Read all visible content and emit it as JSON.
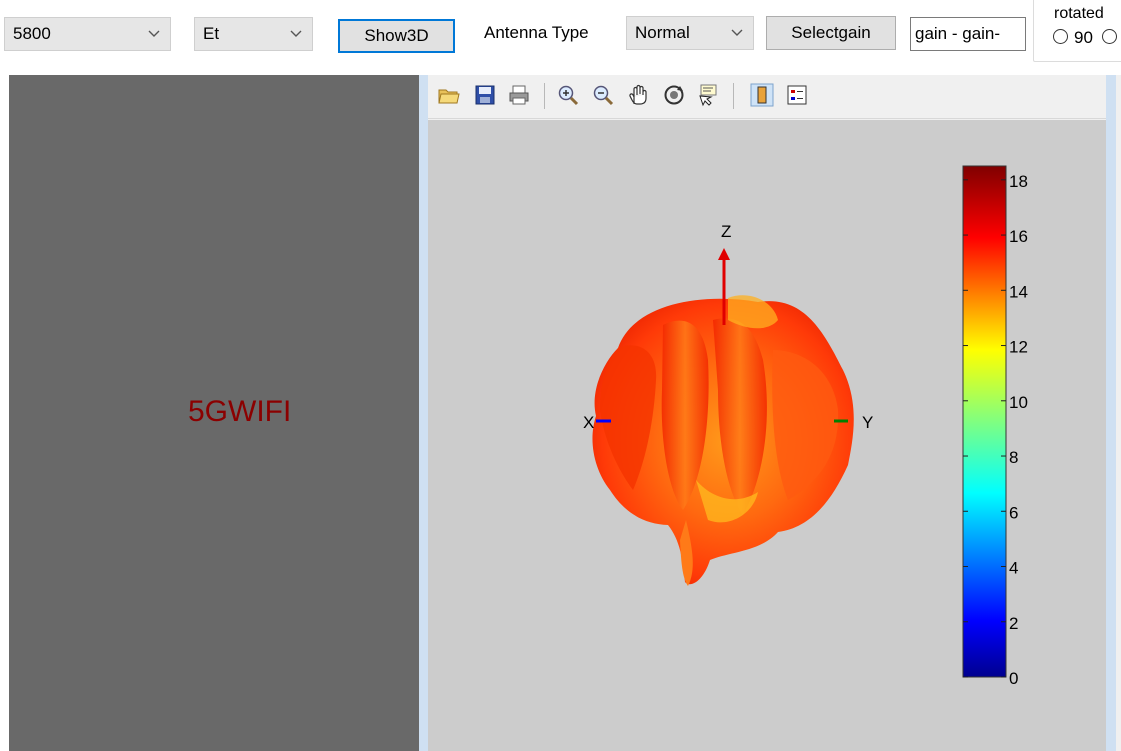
{
  "toolbar": {
    "frequency_select": {
      "value": "5800"
    },
    "field_select": {
      "value": "Et"
    },
    "show3d_label": "Show3D",
    "antenna_type_label": "Antenna Type",
    "antenna_type_select": {
      "value": "Normal"
    },
    "selectgain_label": "Selectgain",
    "gain_field_value": "gain - gain-",
    "rotated_group": {
      "title": "rotated",
      "option_label": "90"
    }
  },
  "left_panel": {
    "label": "5GWIFI"
  },
  "figure_toolbar": {
    "icons": [
      "open-file-icon",
      "save-icon",
      "print-icon",
      "zoom-in-icon",
      "zoom-out-icon",
      "pan-hand-icon",
      "rotate-3d-icon",
      "data-cursor-icon",
      "colorbar-icon",
      "legend-icon"
    ]
  },
  "plot": {
    "axis_labels": {
      "z": "Z",
      "x": "X",
      "y": "Y"
    },
    "colorbar": {
      "ticks": [
        "0",
        "2",
        "4",
        "6",
        "8",
        "10",
        "12",
        "14",
        "16",
        "18"
      ],
      "min": 0,
      "max": 18.5
    },
    "colors": {
      "x_axis": "#0000ff",
      "y_axis": "#008000",
      "z_axis": "#e00000"
    }
  }
}
